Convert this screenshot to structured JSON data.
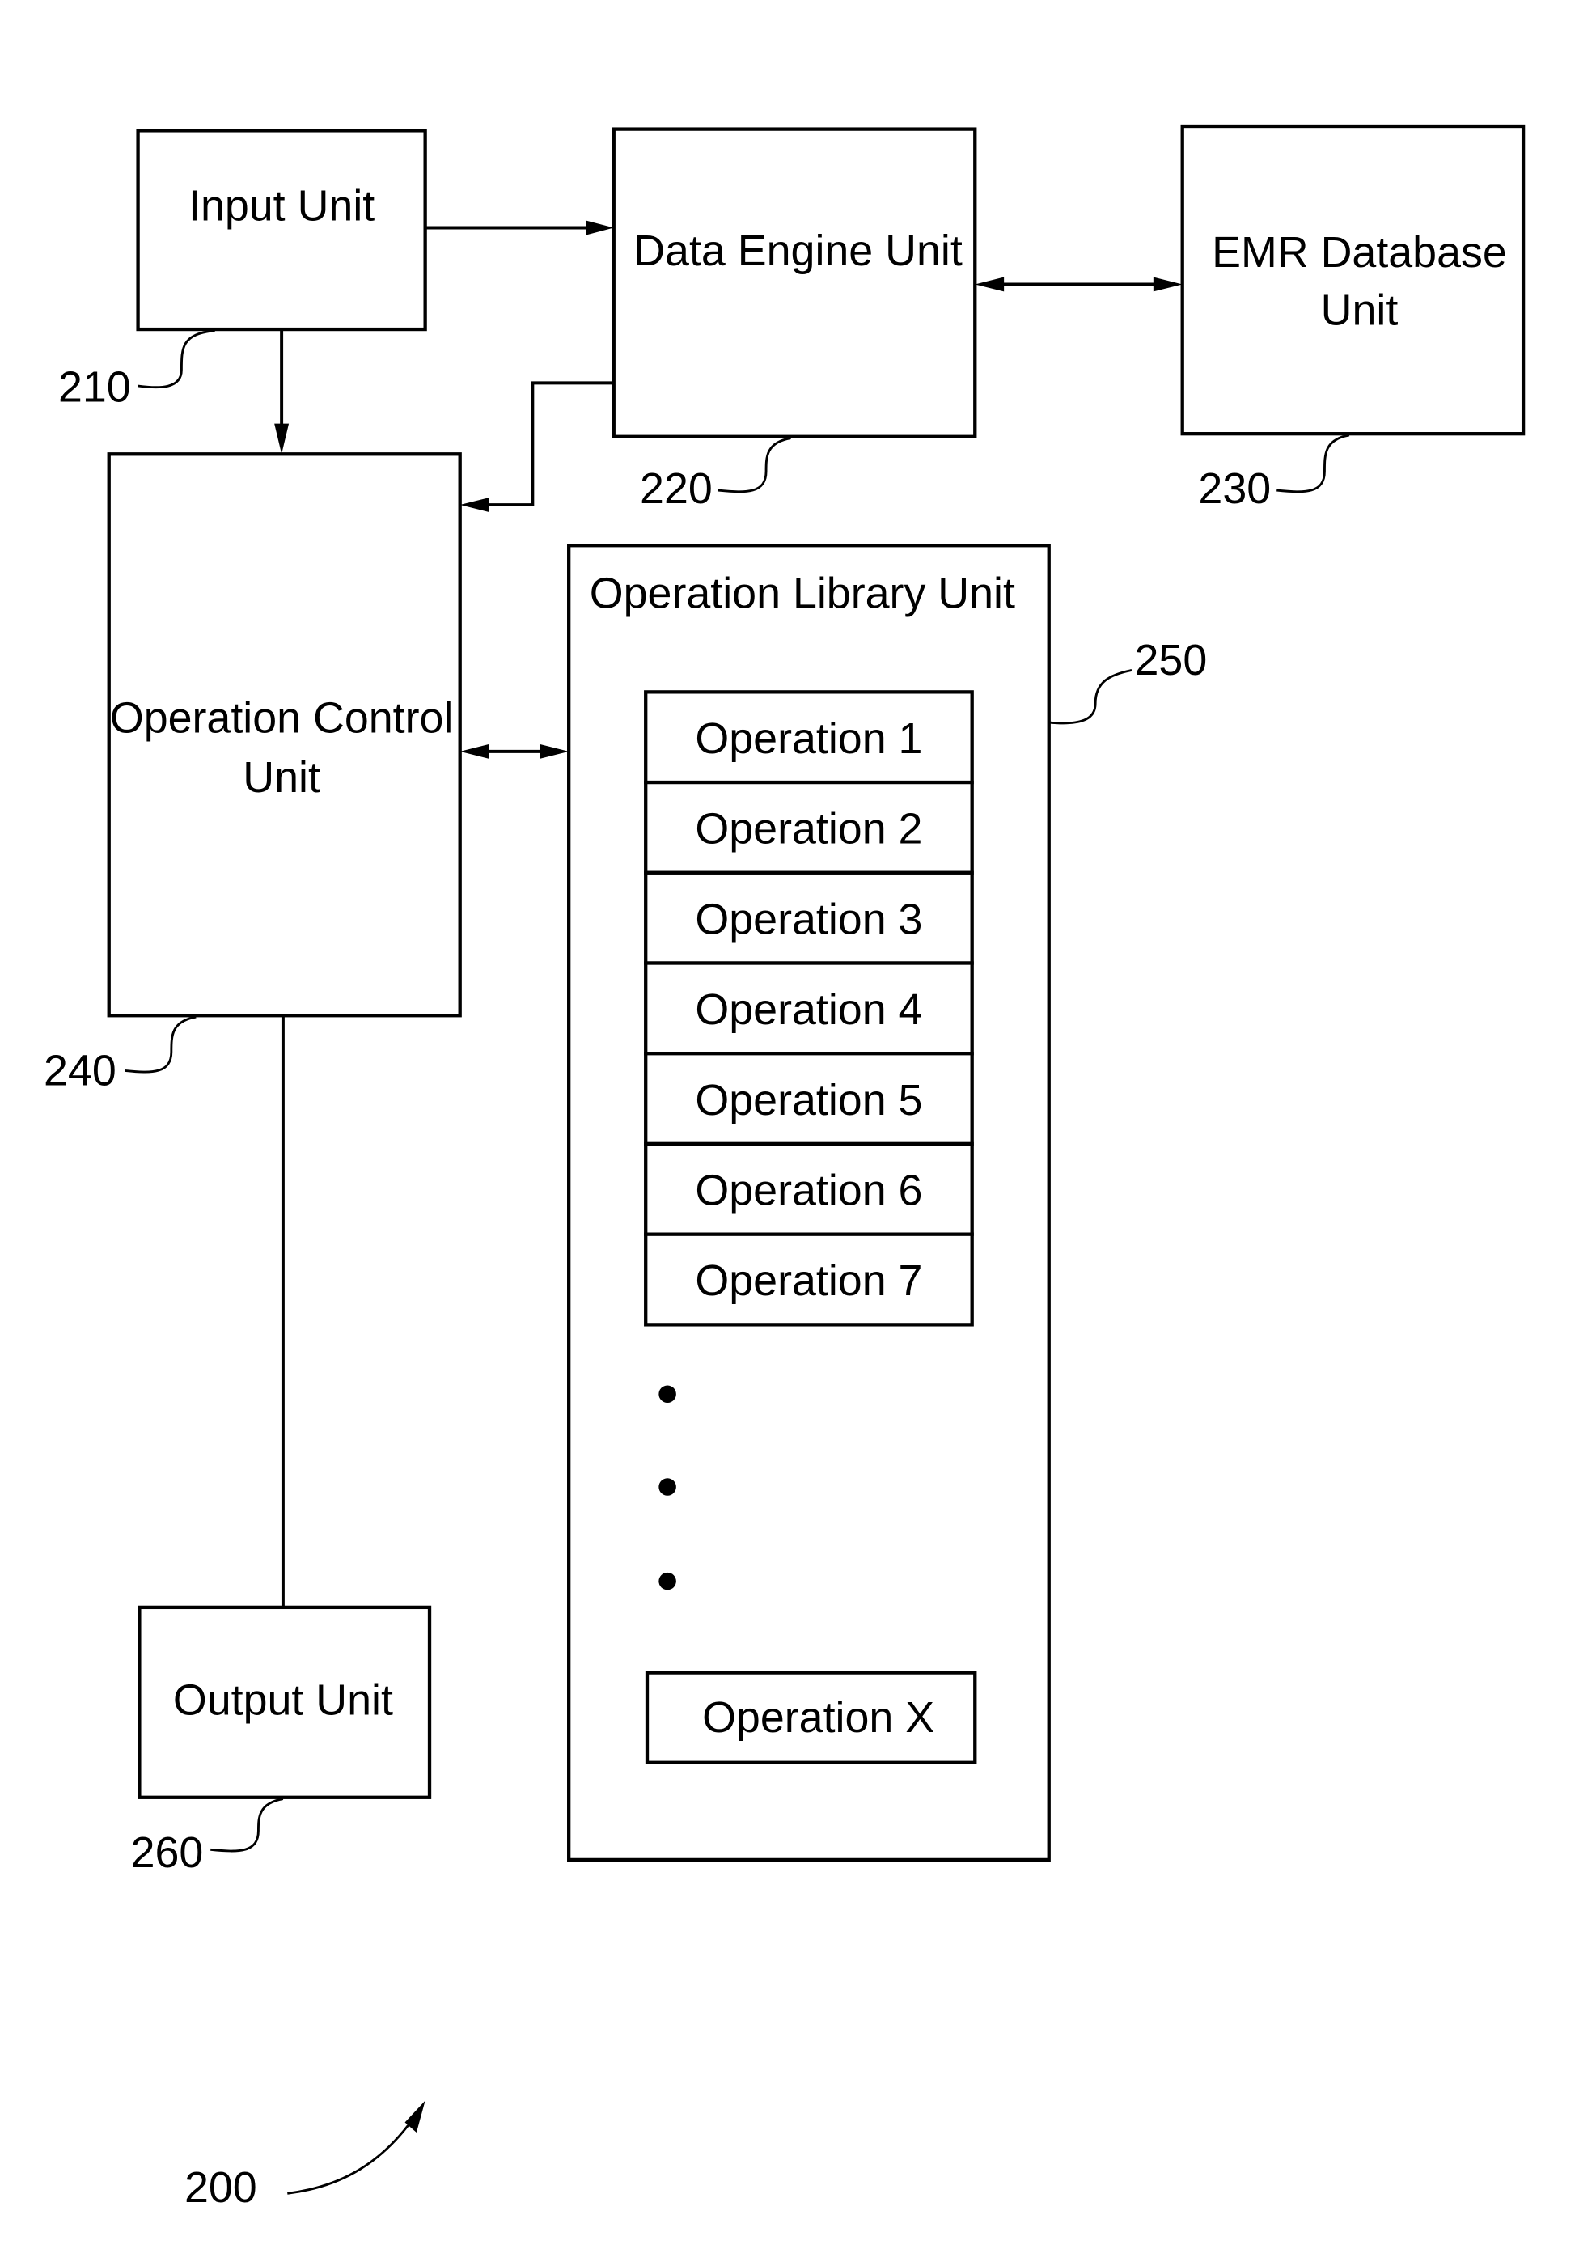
{
  "figure": {
    "number": "200",
    "units": [
      {
        "id": "input",
        "label_lines": [
          "Input Unit"
        ],
        "ref": "210"
      },
      {
        "id": "data-engine",
        "label_lines": [
          "Data Engine Unit"
        ],
        "ref": "220"
      },
      {
        "id": "emr-database",
        "label_lines": [
          "EMR Database",
          "Unit"
        ],
        "ref": "230"
      },
      {
        "id": "operation-control",
        "label_lines": [
          "Operation Control",
          "Unit"
        ],
        "ref": "240"
      },
      {
        "id": "operation-library",
        "label_lines": [
          "Operation Library Unit"
        ],
        "ref": "250"
      },
      {
        "id": "output",
        "label_lines": [
          "Output Unit"
        ],
        "ref": "260"
      }
    ],
    "operations": [
      "Operation 1",
      "Operation 2",
      "Operation 3",
      "Operation 4",
      "Operation 5",
      "Operation 6",
      "Operation 7"
    ],
    "ellipsis_count": 3,
    "last_operation": "Operation X",
    "connections": [
      {
        "from": "input",
        "to": "data-engine",
        "direction": "one-way"
      },
      {
        "from": "input",
        "to": "operation-control",
        "direction": "one-way"
      },
      {
        "from": "data-engine",
        "to": "emr-database",
        "direction": "two-way"
      },
      {
        "from": "data-engine",
        "to": "operation-control",
        "direction": "one-way"
      },
      {
        "from": "operation-control",
        "to": "operation-library",
        "direction": "two-way"
      },
      {
        "from": "operation-control",
        "to": "output",
        "direction": "line"
      }
    ]
  }
}
